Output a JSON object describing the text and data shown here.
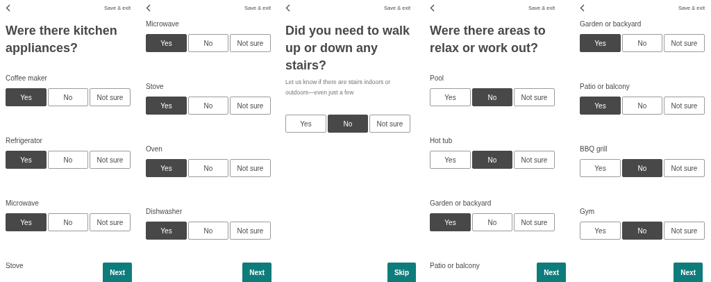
{
  "screens": [
    {
      "action": "Save & exit",
      "title": "Were there kitchen appliances?",
      "questions": [
        {
          "label": "Coffee maker",
          "options": [
            {
              "label": "Yes",
              "selected": true
            },
            {
              "label": "No",
              "selected": false
            },
            {
              "label": "Not sure",
              "selected": false
            }
          ]
        },
        {
          "label": "Refrigerator",
          "options": [
            {
              "label": "Yes",
              "selected": true
            },
            {
              "label": "No",
              "selected": false
            },
            {
              "label": "Not sure",
              "selected": false
            }
          ]
        },
        {
          "label": "Microwave",
          "options": [
            {
              "label": "Yes",
              "selected": true
            },
            {
              "label": "No",
              "selected": false
            },
            {
              "label": "Not sure",
              "selected": false
            }
          ]
        },
        {
          "label": "Stove"
        }
      ],
      "footer_button": "Next"
    },
    {
      "action": "Save & exit",
      "questions": [
        {
          "label": "Microwave",
          "options": [
            {
              "label": "Yes",
              "selected": true
            },
            {
              "label": "No",
              "selected": false
            },
            {
              "label": "Not sure",
              "selected": false
            }
          ]
        },
        {
          "label": "Stove",
          "options": [
            {
              "label": "Yes",
              "selected": true
            },
            {
              "label": "No",
              "selected": false
            },
            {
              "label": "Not sure",
              "selected": false
            }
          ]
        },
        {
          "label": "Oven",
          "options": [
            {
              "label": "Yes",
              "selected": true
            },
            {
              "label": "No",
              "selected": false
            },
            {
              "label": "Not sure",
              "selected": false
            }
          ]
        },
        {
          "label": "Dishwasher",
          "options": [
            {
              "label": "Yes",
              "selected": true
            },
            {
              "label": "No",
              "selected": false
            },
            {
              "label": "Not sure",
              "selected": false
            }
          ]
        }
      ],
      "footer_button": "Next"
    },
    {
      "action": "Save & exit",
      "title": "Did you need to walk up or down any stairs?",
      "subtitle": "Let us know if there are stairs indoors or outdoors—even just a few",
      "questions": [
        {
          "options": [
            {
              "label": "Yes",
              "selected": false
            },
            {
              "label": "No",
              "selected": true
            },
            {
              "label": "Not sure",
              "selected": false
            }
          ]
        }
      ],
      "footer_button": "Skip"
    },
    {
      "action": "Save & exit",
      "title": "Were there areas to relax or work out?",
      "questions": [
        {
          "label": "Pool",
          "options": [
            {
              "label": "Yes",
              "selected": false
            },
            {
              "label": "No",
              "selected": true
            },
            {
              "label": "Not sure",
              "selected": false
            }
          ]
        },
        {
          "label": "Hot tub",
          "options": [
            {
              "label": "Yes",
              "selected": false
            },
            {
              "label": "No",
              "selected": true
            },
            {
              "label": "Not sure",
              "selected": false
            }
          ]
        },
        {
          "label": "Garden or backyard",
          "options": [
            {
              "label": "Yes",
              "selected": true
            },
            {
              "label": "No",
              "selected": false
            },
            {
              "label": "Not sure",
              "selected": false
            }
          ]
        },
        {
          "label": "Patio or balcony"
        }
      ],
      "footer_button": "Next"
    },
    {
      "action": "Save & exit",
      "questions": [
        {
          "label": "Garden or backyard",
          "options": [
            {
              "label": "Yes",
              "selected": true
            },
            {
              "label": "No",
              "selected": false
            },
            {
              "label": "Not sure",
              "selected": false
            }
          ]
        },
        {
          "label": "Patio or balcony",
          "options": [
            {
              "label": "Yes",
              "selected": true
            },
            {
              "label": "No",
              "selected": false
            },
            {
              "label": "Not sure",
              "selected": false
            }
          ]
        },
        {
          "label": "BBQ grill",
          "options": [
            {
              "label": "Yes",
              "selected": false
            },
            {
              "label": "No",
              "selected": true
            },
            {
              "label": "Not sure",
              "selected": false
            }
          ]
        },
        {
          "label": "Gym",
          "options": [
            {
              "label": "Yes",
              "selected": false
            },
            {
              "label": "No",
              "selected": true
            },
            {
              "label": "Not sure",
              "selected": false
            }
          ]
        }
      ],
      "footer_button": "Next"
    }
  ]
}
